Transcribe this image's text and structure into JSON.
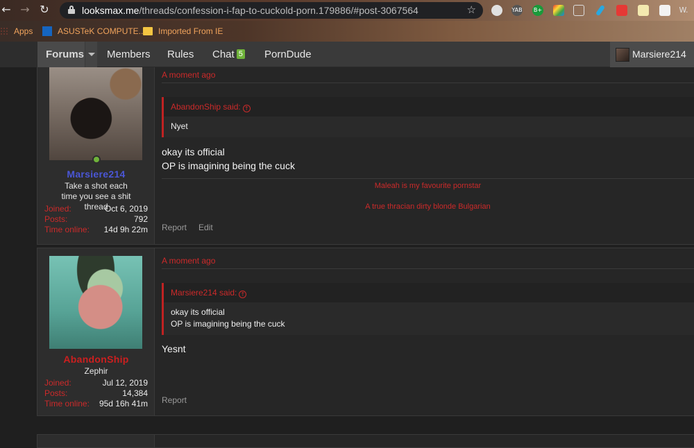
{
  "browser": {
    "url_host": "looksmax.me",
    "url_path": "/threads/confession-i-fap-to-cuckold-porn.179886/#post-3067564",
    "bookmarks": [
      {
        "label": "Apps"
      },
      {
        "label": "ASUSTeK COMPUTE..."
      },
      {
        "label": "Imported From IE"
      }
    ],
    "extensions": [
      "YAB",
      "B+",
      "W."
    ]
  },
  "nav": {
    "forums": "Forums",
    "members": "Members",
    "rules": "Rules",
    "chat": "Chat",
    "chat_badge": "5",
    "porndude": "PornDude",
    "user": "Marsiere214"
  },
  "posts": [
    {
      "username": "Marsiere214",
      "username_color": "#4a56d6",
      "user_title": "Take a shot each time you see a shit thread",
      "stats": [
        {
          "k": "Joined:",
          "v": "Oct 6, 2019"
        },
        {
          "k": "Posts:",
          "v": "792"
        },
        {
          "k": "Time online:",
          "v": "14d 9h 22m"
        }
      ],
      "time": "A moment ago",
      "quote_author": "AbandonShip said:",
      "quote_lines": [
        "Nyet"
      ],
      "message_lines": [
        "okay its official",
        "OP is imagining being the cuck"
      ],
      "signature": [
        "Maleah is my favourite pornstar",
        "A true thracian dirty blonde Bulgarian"
      ],
      "actions": [
        "Report",
        "Edit"
      ]
    },
    {
      "username": "AbandonShip",
      "username_color": "#cc1f1f",
      "user_title": "Zephir",
      "stats": [
        {
          "k": "Joined:",
          "v": "Jul 12, 2019"
        },
        {
          "k": "Posts:",
          "v": "14,384"
        },
        {
          "k": "Time online:",
          "v": "95d 16h 41m"
        }
      ],
      "time": "A moment ago",
      "quote_author": "Marsiere214 said:",
      "quote_lines": [
        "okay its official",
        "OP is imagining being the cuck"
      ],
      "message_lines": [
        "Yesnt"
      ],
      "actions": [
        "Report"
      ]
    }
  ]
}
